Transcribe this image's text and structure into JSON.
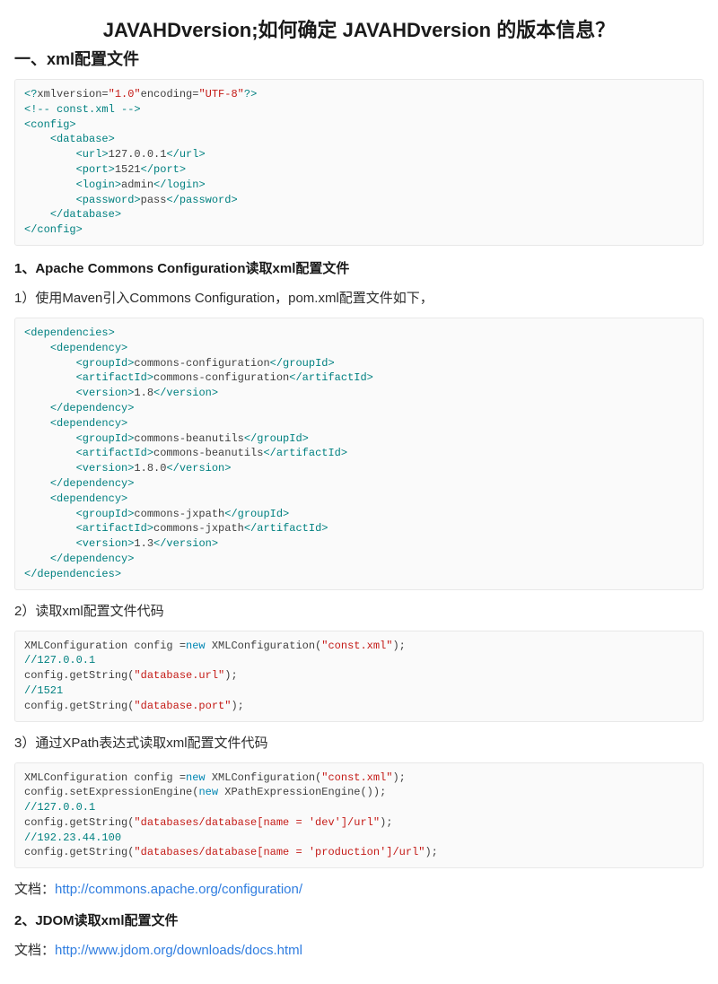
{
  "title": "JAVAHDversion;如何确定 JAVAHDversion 的版本信息？",
  "h_section1": "一、xml配置文件",
  "code1_html": "<span style='color:#008080'>&lt;?</span>xmlversion=<span style='color:#c41a16'>\"1.0\"</span>encoding=<span style='color:#c41a16'>\"UTF-8\"</span><span style='color:#008080'>?&gt;</span>\n<span style='color:#008080'>&lt;!-- const.xml --&gt;</span>\n<span style='color:#008080'>&lt;config&gt;</span>\n    <span style='color:#008080'>&lt;database&gt;</span>\n        <span style='color:#008080'>&lt;url&gt;</span>127.0.0.1<span style='color:#008080'>&lt;/url&gt;</span>\n        <span style='color:#008080'>&lt;port&gt;</span>1521<span style='color:#008080'>&lt;/port&gt;</span>\n        <span style='color:#008080'>&lt;login&gt;</span>admin<span style='color:#008080'>&lt;/login&gt;</span>\n        <span style='color:#008080'>&lt;password&gt;</span>pass<span style='color:#008080'>&lt;/password&gt;</span>\n    <span style='color:#008080'>&lt;/database&gt;</span>\n<span style='color:#008080'>&lt;/config&gt;</span>",
  "h_sub1": "1、Apache Commons Configuration读取xml配置文件",
  "p1": "1）使用Maven引入Commons Configuration，pom.xml配置文件如下，",
  "code2_html": "<span style='color:#008080'>&lt;dependencies&gt;</span>\n    <span style='color:#008080'>&lt;dependency&gt;</span>\n        <span style='color:#008080'>&lt;groupId&gt;</span>commons-configuration<span style='color:#008080'>&lt;/groupId&gt;</span>\n        <span style='color:#008080'>&lt;artifactId&gt;</span>commons-configuration<span style='color:#008080'>&lt;/artifactId&gt;</span>\n        <span style='color:#008080'>&lt;version&gt;</span>1.8<span style='color:#008080'>&lt;/version&gt;</span>\n    <span style='color:#008080'>&lt;/dependency&gt;</span>\n    <span style='color:#008080'>&lt;dependency&gt;</span>\n        <span style='color:#008080'>&lt;groupId&gt;</span>commons-beanutils<span style='color:#008080'>&lt;/groupId&gt;</span>\n        <span style='color:#008080'>&lt;artifactId&gt;</span>commons-beanutils<span style='color:#008080'>&lt;/artifactId&gt;</span>\n        <span style='color:#008080'>&lt;version&gt;</span>1.8.0<span style='color:#008080'>&lt;/version&gt;</span>\n    <span style='color:#008080'>&lt;/dependency&gt;</span>\n    <span style='color:#008080'>&lt;dependency&gt;</span>\n        <span style='color:#008080'>&lt;groupId&gt;</span>commons-jxpath<span style='color:#008080'>&lt;/groupId&gt;</span>\n        <span style='color:#008080'>&lt;artifactId&gt;</span>commons-jxpath<span style='color:#008080'>&lt;/artifactId&gt;</span>\n        <span style='color:#008080'>&lt;version&gt;</span>1.3<span style='color:#008080'>&lt;/version&gt;</span>\n    <span style='color:#008080'>&lt;/dependency&gt;</span>\n<span style='color:#008080'>&lt;/dependencies&gt;</span>",
  "p2": "2）读取xml配置文件代码",
  "code3_html": "XMLConfiguration config =<span style='color:#0086b3'>new</span> XMLConfiguration(<span style='color:#c41a16'>\"const.xml\"</span>);\n<span style='color:#008080'>//127.0.0.1</span>\nconfig.getString(<span style='color:#c41a16'>\"database.url\"</span>);\n<span style='color:#008080'>//1521</span>\nconfig.getString(<span style='color:#c41a16'>\"database.port\"</span>);",
  "p3": "3）通过XPath表达式读取xml配置文件代码",
  "code4_html": "XMLConfiguration config =<span style='color:#0086b3'>new</span> XMLConfiguration(<span style='color:#c41a16'>\"const.xml\"</span>);\nconfig.setExpressionEngine(<span style='color:#0086b3'>new</span> XPathExpressionEngine());\n<span style='color:#008080'>//127.0.0.1</span>\nconfig.getString(<span style='color:#c41a16'>\"databases/database[name = 'dev']/url\"</span>);\n<span style='color:#008080'>//192.23.44.100</span>\nconfig.getString(<span style='color:#c41a16'>\"databases/database[name = 'production']/url\"</span>);",
  "doc1_label": "文档：",
  "doc1_link": "http://commons.apache.org/configuration/",
  "h_sub2": "2、JDOM读取xml配置文件",
  "doc2_label": "文档：",
  "doc2_link": "http://www.jdom.org/downloads/docs.html"
}
